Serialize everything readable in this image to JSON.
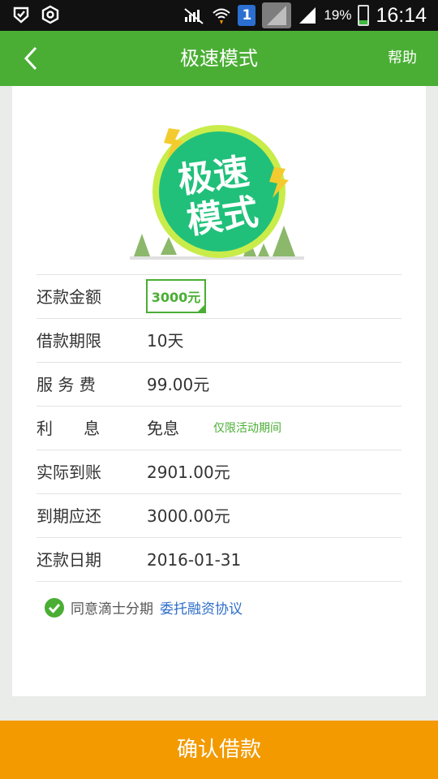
{
  "status_bar": {
    "sim_number": "1",
    "battery_pct": "19%",
    "time": "16:14"
  },
  "header": {
    "title": "极速模式",
    "help_label": "帮助"
  },
  "logo": {
    "line1": "极速",
    "line2": "模式"
  },
  "details": {
    "amount": {
      "label": "还款金额",
      "value": "3000元"
    },
    "term": {
      "label": "借款期限",
      "value": "10天"
    },
    "fee": {
      "label": "服 务 费",
      "value": "99.00元"
    },
    "interest": {
      "label": "利      息",
      "value": "免息",
      "note": "仅限活动期间"
    },
    "received": {
      "label": "实际到账",
      "value": "2901.00元"
    },
    "due": {
      "label": "到期应还",
      "value": "3000.00元"
    },
    "date": {
      "label": "还款日期",
      "value": "2016-01-31"
    }
  },
  "agreement": {
    "text": "同意滴士分期",
    "link": "委托融资协议"
  },
  "confirm_label": "确认借款",
  "colors": {
    "brand_green": "#4aae34",
    "confirm_orange": "#f29a00",
    "link_blue": "#2e6ec9"
  }
}
